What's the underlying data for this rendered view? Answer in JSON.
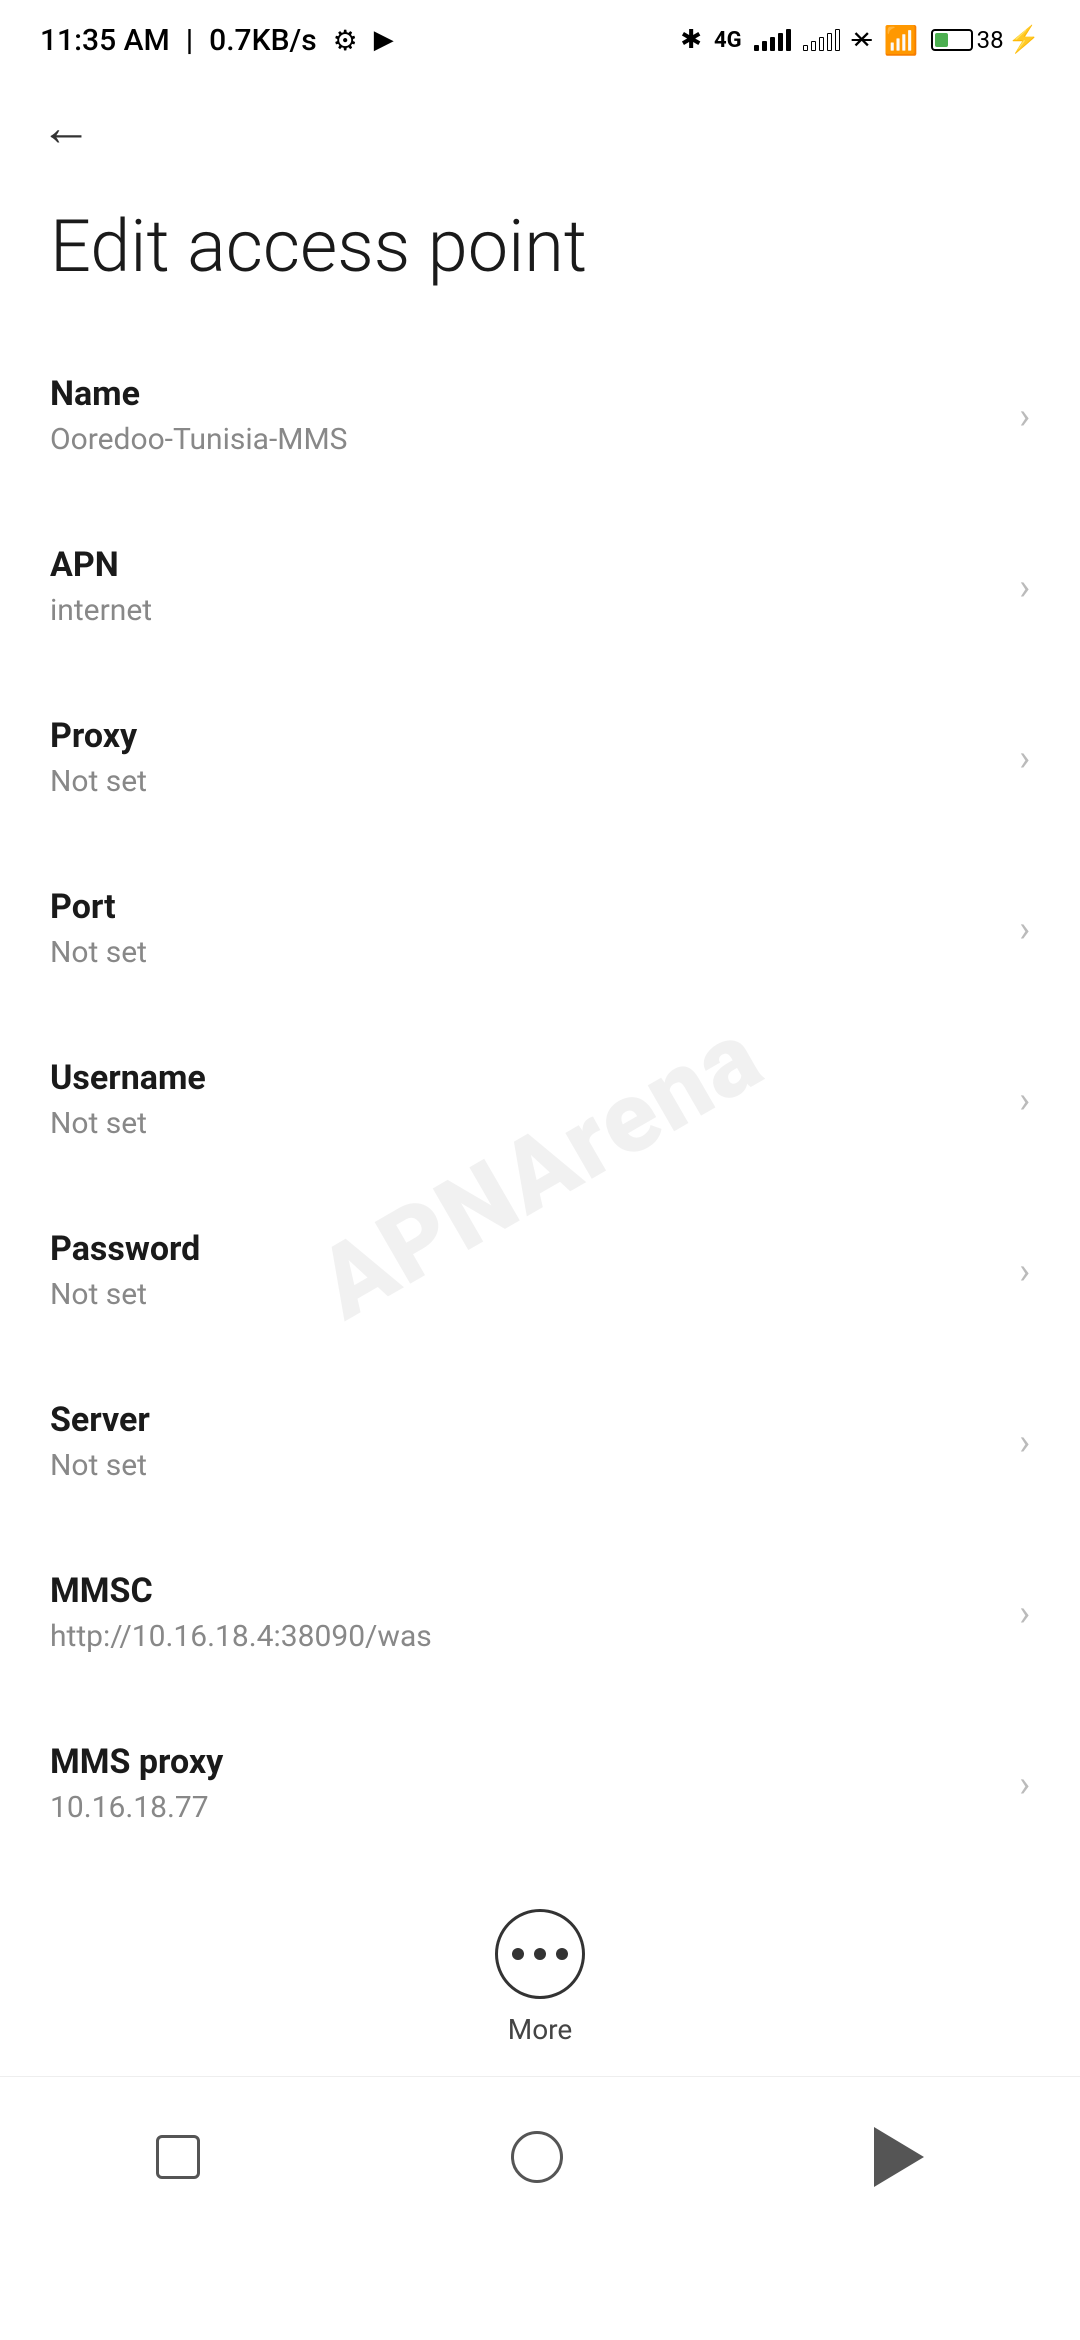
{
  "status_bar": {
    "time": "11:35 AM",
    "data_speed": "0.7KB/s",
    "battery_percent": "38"
  },
  "toolbar": {
    "back_label": "←"
  },
  "page": {
    "title": "Edit access point"
  },
  "settings_items": [
    {
      "label": "Name",
      "value": "Ooredoo-Tunisia-MMS"
    },
    {
      "label": "APN",
      "value": "internet"
    },
    {
      "label": "Proxy",
      "value": "Not set"
    },
    {
      "label": "Port",
      "value": "Not set"
    },
    {
      "label": "Username",
      "value": "Not set"
    },
    {
      "label": "Password",
      "value": "Not set"
    },
    {
      "label": "Server",
      "value": "Not set"
    },
    {
      "label": "MMSC",
      "value": "http://10.16.18.4:38090/was"
    },
    {
      "label": "MMS proxy",
      "value": "10.16.18.77"
    }
  ],
  "more_button": {
    "label": "More"
  },
  "watermark": {
    "text": "APNArena"
  }
}
